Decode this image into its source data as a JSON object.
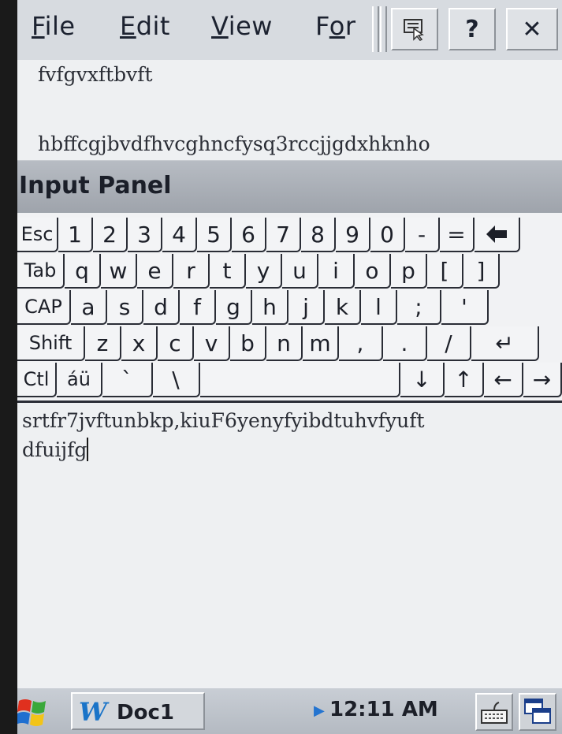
{
  "menubar": {
    "items": [
      {
        "label": "File",
        "mnemonic": "F"
      },
      {
        "label": "Edit",
        "mnemonic": "E"
      },
      {
        "label": "View",
        "mnemonic": "V"
      },
      {
        "label": "For",
        "mnemonic": "o"
      }
    ],
    "help_label": "?",
    "close_label": "✕",
    "icons": [
      "input-method-icon",
      "help-icon",
      "close-icon"
    ]
  },
  "document": {
    "line1": "fvfgvxftbvft",
    "line2": "hbffcgjbvdfhvcghncfysq3rccjjgdxhknho"
  },
  "input_panel": {
    "title": "Input Panel"
  },
  "keyboard": {
    "row1": [
      "Esc",
      "1",
      "2",
      "3",
      "4",
      "5",
      "6",
      "7",
      "8",
      "9",
      "0",
      "-",
      "=",
      "🡐"
    ],
    "row2": [
      "Tab",
      "q",
      "w",
      "e",
      "r",
      "t",
      "y",
      "u",
      "i",
      "o",
      "p",
      "[",
      "]"
    ],
    "row3": [
      "CAP",
      "a",
      "s",
      "d",
      "f",
      "g",
      "h",
      "j",
      "k",
      "l",
      ";",
      "'"
    ],
    "row4": [
      "Shift",
      "z",
      "x",
      "c",
      "v",
      "b",
      "n",
      "m",
      ",",
      ".",
      "/",
      "↵"
    ],
    "row5": [
      "Ctl",
      "áü",
      "`",
      "\\",
      "",
      "↓",
      "↑",
      "←",
      "→"
    ]
  },
  "text_area": {
    "line1": "srtfr7jvftunbkp,kiuF6yenyfyibdtuhvfyuft",
    "line2": "dfuijfg"
  },
  "taskbar": {
    "start_icon": "windows-flag-icon",
    "task_label": "Doc1",
    "clock": "12:11 AM",
    "tray_icons": [
      "keyboard-icon",
      "desktop-icon"
    ]
  },
  "colors": {
    "menubar_bg": "#d7dbe0",
    "panel_header_bg": "#a7acb4",
    "taskbar_bg": "#c1c6cd",
    "word_blue": "#1a74c8"
  }
}
